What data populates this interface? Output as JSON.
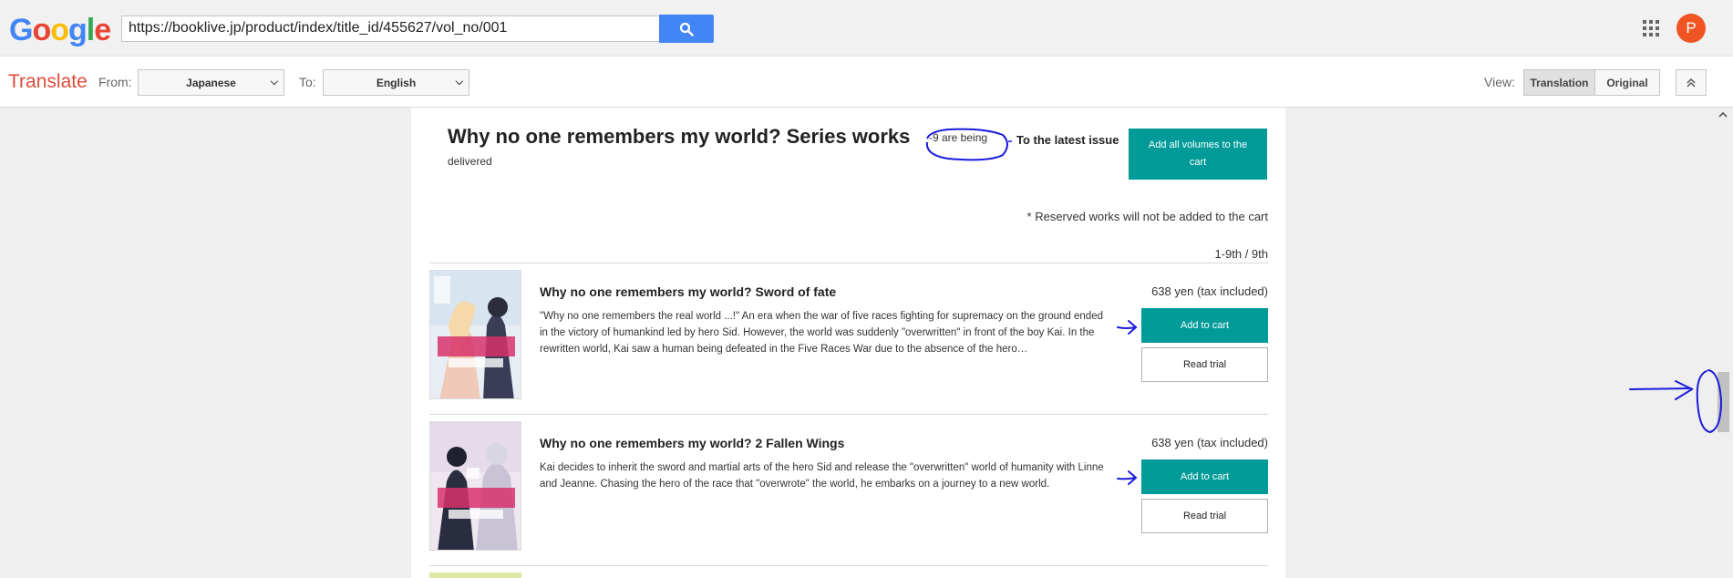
{
  "google": {
    "logo_letters": [
      {
        "ch": "G",
        "color": "#4285f4"
      },
      {
        "ch": "o",
        "color": "#ea4335"
      },
      {
        "ch": "o",
        "color": "#fbbc05"
      },
      {
        "ch": "g",
        "color": "#4285f4"
      },
      {
        "ch": "l",
        "color": "#34a853"
      },
      {
        "ch": "e",
        "color": "#ea4335"
      }
    ],
    "url": "https://booklive.jp/product/index/title_id/455627/vol_no/001",
    "avatar_letter": "P",
    "avatar_color": "#ef5422"
  },
  "translate": {
    "title": "Translate",
    "from_label": "From:",
    "from_value": "Japanese",
    "to_label": "To:",
    "to_value": "English",
    "view_label": "View:",
    "view_translation": "Translation",
    "view_original": "Original",
    "view_selected": "Translation"
  },
  "series": {
    "title": "Why no one remembers my world? Series works",
    "count_text": "-9 are being",
    "delivered_text": "delivered",
    "latest_link": "To the latest issue",
    "add_all_button": "Add all volumes to the cart",
    "reserved_note": "* Reserved works will not be added to the cart",
    "range_text": "1-9th / 9th"
  },
  "books": [
    {
      "title": "Why no one remembers my world? Sword of fate",
      "description": "\"Why no one remembers the real world ...!\" An era when the war of five races fighting for supremacy on the ground ended in the victory of humankind led by hero Sid. However, the world was suddenly \"overwritten\" in front of the boy Kai. In the rewritten world, Kai saw a human being defeated in the Five Races War due to the absence of the hero…",
      "price": "638 yen (tax included)",
      "cart_button": "Add to cart",
      "trial_button": "Read trial"
    },
    {
      "title": "Why no one remembers my world? 2 Fallen Wings",
      "description": "Kai decides to inherit the sword and martial arts of the hero Sid and release the \"overwritten\" world of humanity with Linne and Jeanne. Chasing the hero of the race that \"overwrote\" the world, he embarks on a journey to a new world.",
      "price": "638 yen (tax included)",
      "cart_button": "Add to cart",
      "trial_button": "Read trial"
    }
  ],
  "colors": {
    "accent_teal": "#009b98",
    "google_blue": "#4285f4",
    "translate_red": "#dd4b39",
    "annotation_blue": "#1a1adb"
  }
}
